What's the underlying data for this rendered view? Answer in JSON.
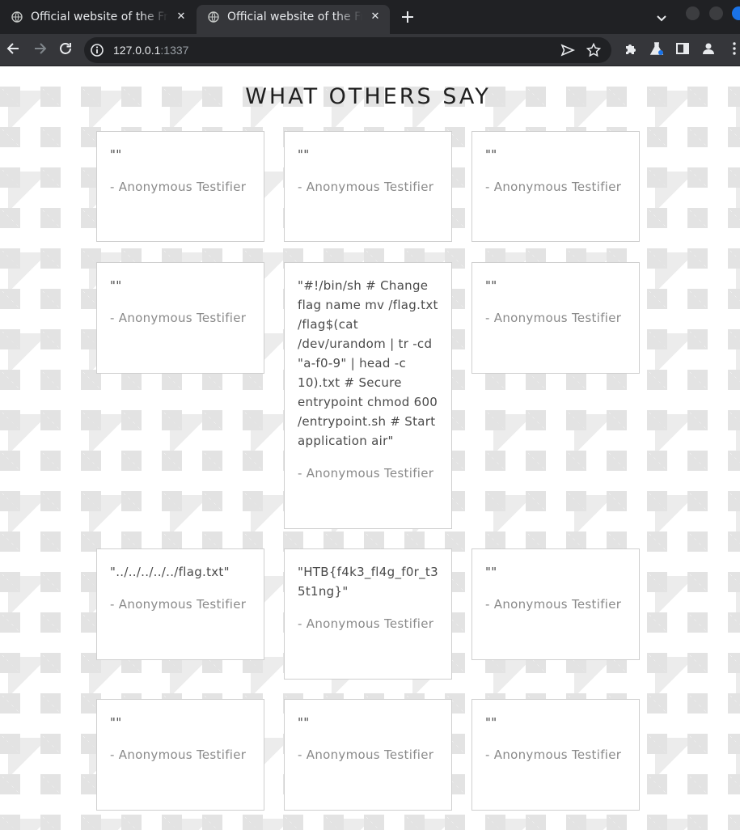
{
  "browser": {
    "tabs": [
      {
        "title": "Official website of the Fra",
        "active": false
      },
      {
        "title": "Official website of the Fra",
        "active": true
      }
    ],
    "url": {
      "host": "127.0.0.1",
      "port": ":1337"
    },
    "icons": [
      "globe-icon",
      "close-icon",
      "plus-icon",
      "chevron-down-icon",
      "back-arrow-icon",
      "forward-arrow-icon",
      "reload-icon",
      "info-icon",
      "send-icon",
      "star-icon",
      "puzzle-icon",
      "flask-icon",
      "side-panel-icon",
      "profile-icon",
      "kebab-menu-icon"
    ]
  },
  "page": {
    "section_title": "WHAT OTHERS SAY",
    "testimonials": [
      {
        "quote": "\"\"",
        "author": "- Anonymous Testifier"
      },
      {
        "quote": "\"\"",
        "author": "- Anonymous Testifier"
      },
      {
        "quote": "\"\"",
        "author": "- Anonymous Testifier"
      },
      {
        "quote": "\"\"",
        "author": "- Anonymous Testifier"
      },
      {
        "quote": "\"#!/bin/sh # Change flag name mv /flag.txt /flag$(cat /dev/urandom | tr -cd \"a-f0-9\" | head -c 10).txt # Secure entrypoint chmod 600 /entrypoint.sh # Start application air\"",
        "author": "- Anonymous Testifier"
      },
      {
        "quote": "\"\"",
        "author": "- Anonymous Testifier"
      },
      {
        "quote": "\"../../../../../flag.txt\"",
        "author": "- Anonymous Testifier"
      },
      {
        "quote": "\"HTB{f4k3_fl4g_f0r_t35t1ng}\"",
        "author": "- Anonymous Testifier"
      },
      {
        "quote": "\"\"",
        "author": "- Anonymous Testifier"
      },
      {
        "quote": "\"\"",
        "author": "- Anonymous Testifier"
      },
      {
        "quote": "\"\"",
        "author": "- Anonymous Testifier"
      },
      {
        "quote": "\"\"",
        "author": "- Anonymous Testifier"
      }
    ]
  }
}
